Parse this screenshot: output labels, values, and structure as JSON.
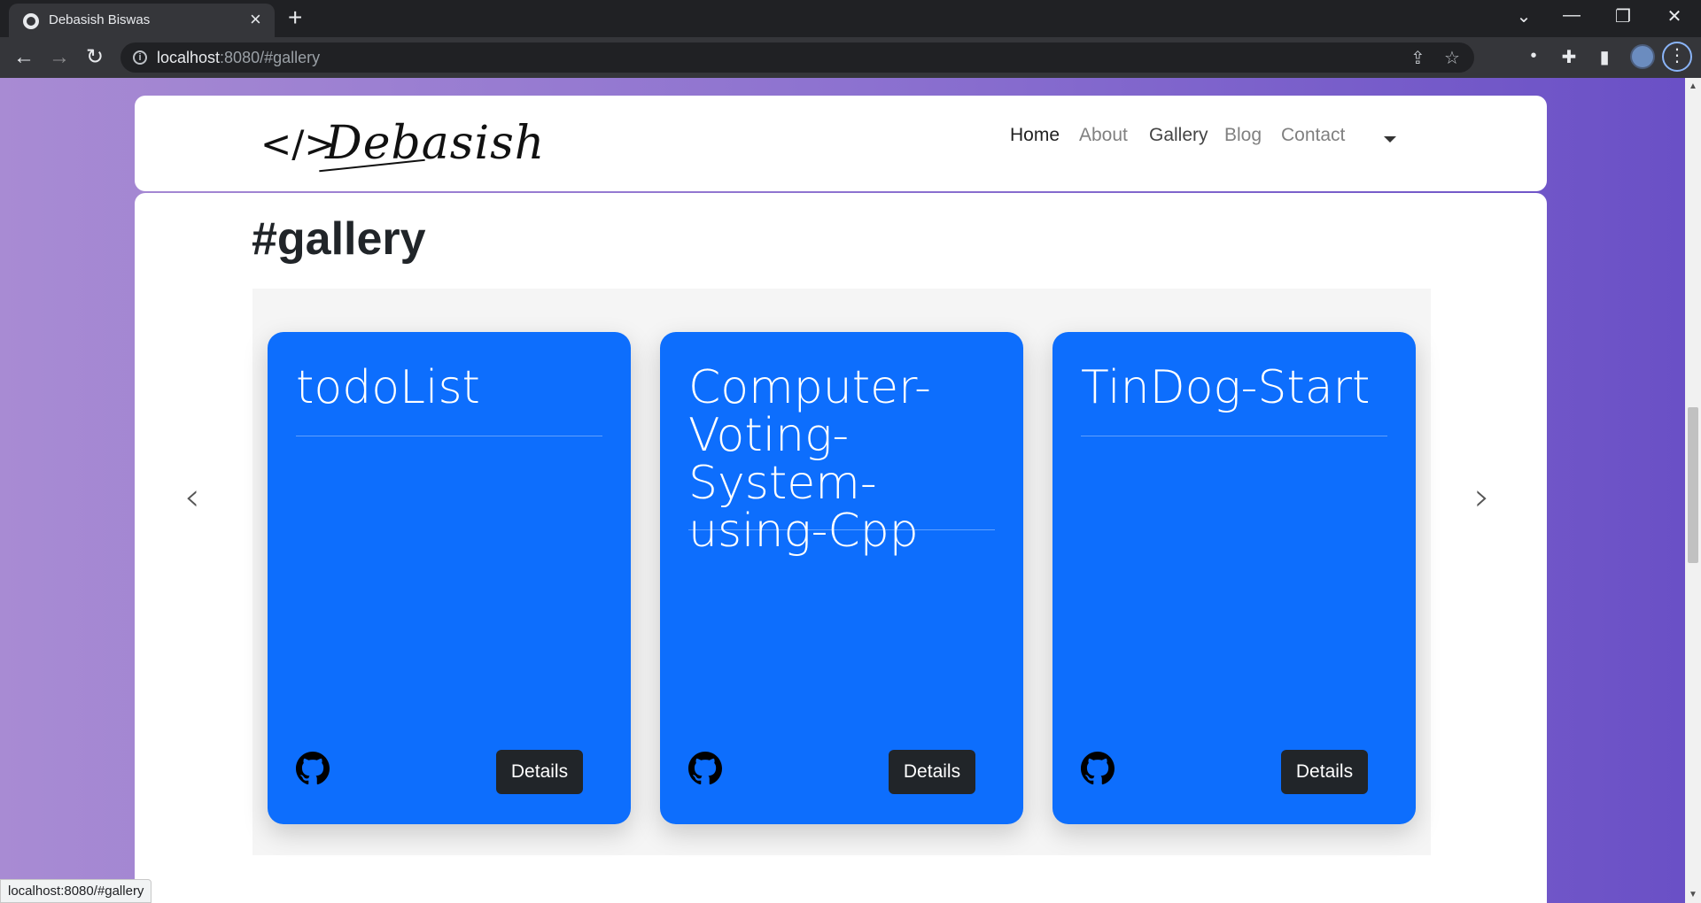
{
  "browser": {
    "tab_title": "Debasish Biswas",
    "url_host": "localhost",
    "url_rest": ":8080/#gallery",
    "status_url": "localhost:8080/#gallery"
  },
  "navbar": {
    "logo_mark": "</>",
    "logo_text": "Debasish",
    "links": [
      "Home",
      "About",
      "Gallery",
      "Blog",
      "Contact"
    ]
  },
  "gallery": {
    "title": "#gallery",
    "cards": [
      {
        "title": "todoList",
        "button": "Details"
      },
      {
        "title": "Computer-Voting-System-using-Cpp",
        "button": "Details"
      },
      {
        "title": "TinDog-Start",
        "button": "Details"
      }
    ]
  },
  "colors": {
    "card": "#0d6efd",
    "button": "#212529",
    "chrome_dark": "#202124"
  }
}
